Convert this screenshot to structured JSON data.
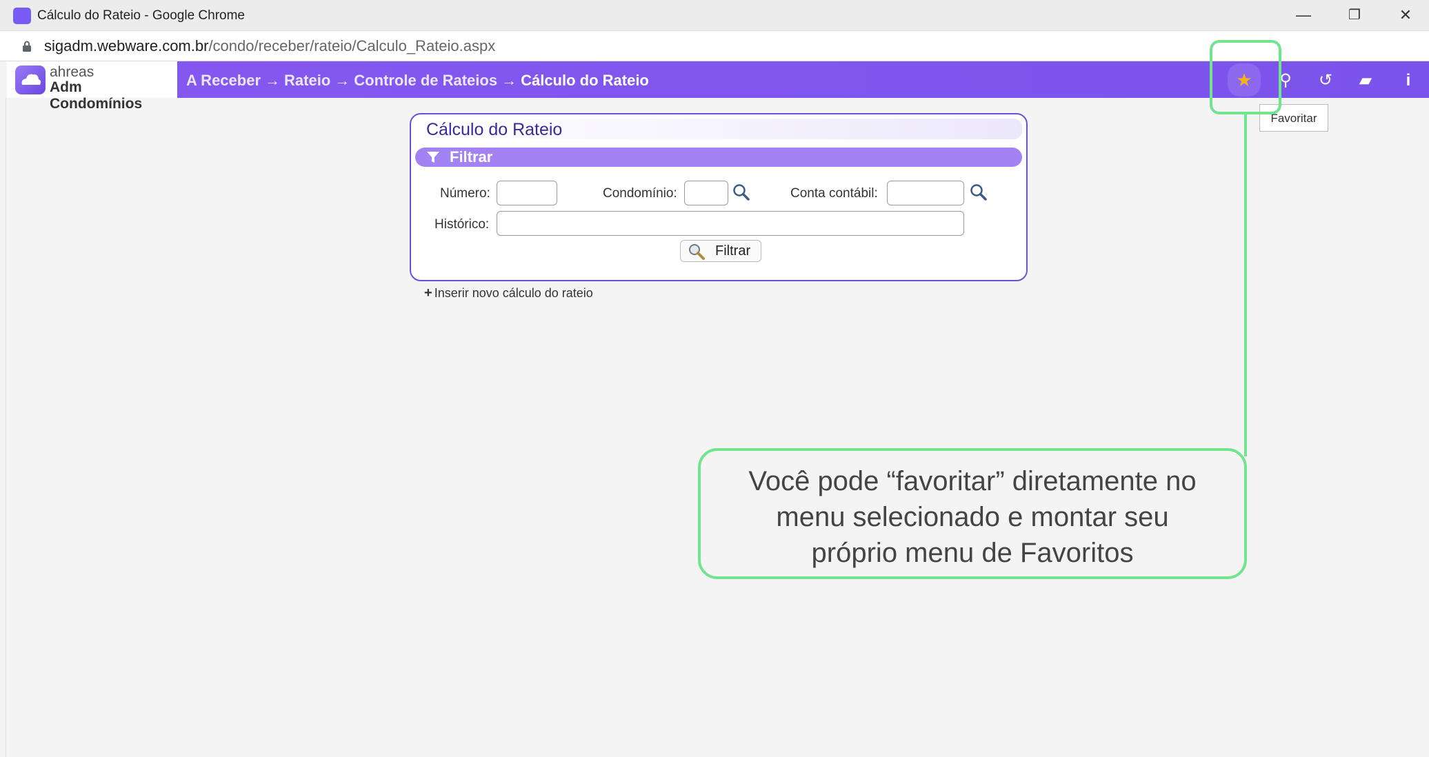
{
  "browser": {
    "window_title": "Cálculo do Rateio - Google Chrome",
    "url_host": "sigadm.webware.com.br",
    "url_path": "/condo/receber/rateio/Calculo_Rateio.aspx",
    "controls": {
      "minimize": "—",
      "restore": "❐",
      "close": "✕"
    }
  },
  "app": {
    "logo_line1": "ahreas",
    "logo_line2": "Adm Condomínios",
    "breadcrumb": {
      "items": [
        "A Receber",
        "Rateio",
        "Controle de Rateios"
      ],
      "current": "Cálculo do Rateio",
      "separator": "→"
    },
    "toolbar": {
      "favorite_icon": "★",
      "link_icon": "⚲",
      "history_icon": "↺",
      "book_icon": "▰",
      "info_icon": "i",
      "tooltip": "Favoritar"
    },
    "accent_color": "#7a53ec"
  },
  "panel": {
    "title": "Cálculo do Rateio",
    "filter_header": "Filtrar",
    "fields": {
      "numero_label": "Número:",
      "numero_value": "",
      "condominio_label": "Condomínio:",
      "condominio_value": "",
      "conta_label": "Conta contábil:",
      "conta_value": "",
      "historico_label": "Histórico:",
      "historico_value": ""
    },
    "filter_button": "Filtrar"
  },
  "insert_link": "Inserir novo cálculo do rateio",
  "annotation": {
    "line1": "Você pode “favoritar” diretamente no",
    "line2": "menu selecionado e montar seu",
    "line3": "próprio menu de Favoritos",
    "highlight_color": "#71e58e"
  }
}
